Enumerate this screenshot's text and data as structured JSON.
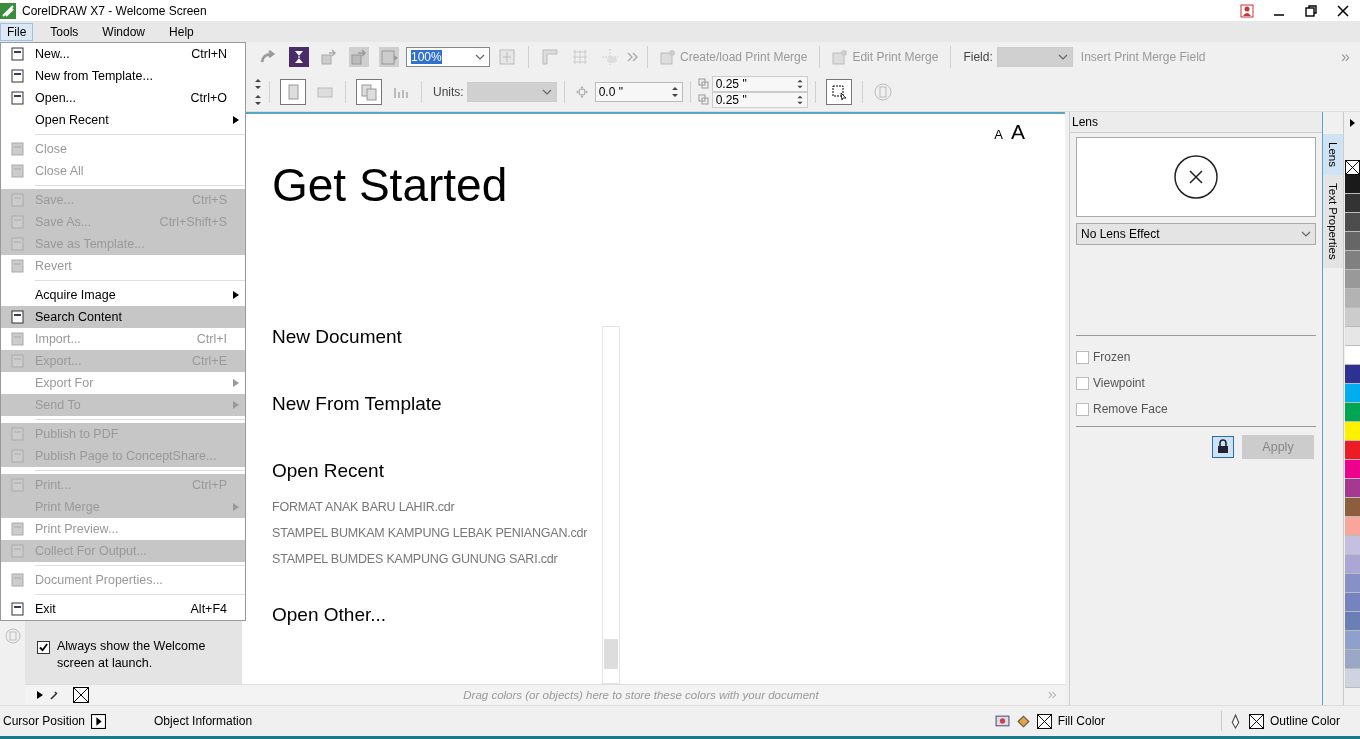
{
  "window": {
    "title": "CorelDRAW X7 - Welcome Screen"
  },
  "menubar": [
    {
      "label": "File",
      "selected": true
    },
    {
      "label": "Tools",
      "selected": false
    },
    {
      "label": "Window",
      "selected": false
    },
    {
      "label": "Help",
      "selected": false
    }
  ],
  "file_menu": [
    {
      "kind": "item",
      "label": "New...",
      "shortcut": "Ctrl+N",
      "disabled": false,
      "highlighted": false,
      "submenu": false,
      "icon": true
    },
    {
      "kind": "item",
      "label": "New from Template...",
      "disabled": false,
      "highlighted": false,
      "submenu": false,
      "icon": true
    },
    {
      "kind": "item",
      "label": "Open...",
      "shortcut": "Ctrl+O",
      "disabled": false,
      "highlighted": false,
      "submenu": false,
      "icon": true
    },
    {
      "kind": "item",
      "label": "Open Recent",
      "disabled": false,
      "highlighted": false,
      "submenu": true,
      "icon": false
    },
    {
      "kind": "separator"
    },
    {
      "kind": "item",
      "label": "Close",
      "disabled": true,
      "highlighted": false,
      "submenu": false,
      "icon": true
    },
    {
      "kind": "item",
      "label": "Close All",
      "disabled": true,
      "highlighted": false,
      "submenu": false,
      "icon": true
    },
    {
      "kind": "separator"
    },
    {
      "kind": "item",
      "label": "Save...",
      "shortcut": "Ctrl+S",
      "disabled": true,
      "highlighted": true,
      "submenu": false,
      "icon": true
    },
    {
      "kind": "item",
      "label": "Save As...",
      "shortcut": "Ctrl+Shift+S",
      "disabled": true,
      "highlighted": true,
      "submenu": false,
      "icon": true
    },
    {
      "kind": "item",
      "label": "Save as Template...",
      "disabled": true,
      "highlighted": true,
      "submenu": false,
      "icon": true
    },
    {
      "kind": "item",
      "label": "Revert",
      "disabled": true,
      "highlighted": false,
      "submenu": false,
      "icon": true
    },
    {
      "kind": "separator"
    },
    {
      "kind": "item",
      "label": "Acquire Image",
      "disabled": false,
      "highlighted": false,
      "submenu": true,
      "icon": false
    },
    {
      "kind": "item",
      "label": "Search Content",
      "disabled": false,
      "highlighted": true,
      "submenu": false,
      "icon": true
    },
    {
      "kind": "item",
      "label": "Import...",
      "shortcut": "Ctrl+I",
      "disabled": true,
      "highlighted": false,
      "submenu": false,
      "icon": true
    },
    {
      "kind": "item",
      "label": "Export...",
      "shortcut": "Ctrl+E",
      "disabled": true,
      "highlighted": true,
      "submenu": false,
      "icon": true
    },
    {
      "kind": "item",
      "label": "Export For",
      "disabled": true,
      "highlighted": false,
      "submenu": true,
      "icon": false
    },
    {
      "kind": "item",
      "label": "Send To",
      "disabled": true,
      "highlighted": true,
      "submenu": true,
      "icon": false
    },
    {
      "kind": "separator"
    },
    {
      "kind": "item",
      "label": "Publish to PDF",
      "disabled": true,
      "highlighted": true,
      "submenu": false,
      "icon": true
    },
    {
      "kind": "item",
      "label": "Publish Page to ConceptShare...",
      "disabled": true,
      "highlighted": true,
      "submenu": false,
      "icon": true
    },
    {
      "kind": "separator"
    },
    {
      "kind": "item",
      "label": "Print...",
      "shortcut": "Ctrl+P",
      "disabled": true,
      "highlighted": true,
      "submenu": false,
      "icon": true
    },
    {
      "kind": "item",
      "label": "Print Merge",
      "disabled": true,
      "highlighted": true,
      "submenu": true,
      "icon": false
    },
    {
      "kind": "item",
      "label": "Print Preview...",
      "disabled": true,
      "highlighted": false,
      "submenu": false,
      "icon": true
    },
    {
      "kind": "item",
      "label": "Collect For Output...",
      "disabled": true,
      "highlighted": true,
      "submenu": false,
      "icon": true
    },
    {
      "kind": "separator"
    },
    {
      "kind": "item",
      "label": "Document Properties...",
      "disabled": true,
      "highlighted": false,
      "submenu": false,
      "icon": true
    },
    {
      "kind": "separator"
    },
    {
      "kind": "item",
      "label": "Exit",
      "shortcut": "Alt+F4",
      "disabled": false,
      "highlighted": false,
      "submenu": false,
      "icon": true
    }
  ],
  "toolbar": {
    "zoom": "100%",
    "create_merge": "Create/load Print Merge",
    "edit_merge": "Edit Print Merge",
    "field_label": "Field:",
    "insert_field": "Insert Print Merge Field",
    "chevron": "»"
  },
  "property_bar": {
    "units_label": "Units:",
    "nudge": "0.0 \"",
    "dup_x": "0.25 \"",
    "dup_y": "0.25 \""
  },
  "welcome": {
    "font_small": "A",
    "font_large": "A",
    "heading": "Get Started",
    "links": [
      {
        "kind": "heading",
        "label": "New Document"
      },
      {
        "kind": "heading",
        "label": "New From Template"
      },
      {
        "kind": "heading",
        "label": "Open Recent"
      },
      {
        "kind": "file",
        "label": "FORMAT ANAK BARU LAHIR.cdr"
      },
      {
        "kind": "file",
        "label": "STAMPEL BUMKAM KAMPUNG LEBAK PENIANGAN.cdr"
      },
      {
        "kind": "file",
        "label": "STAMPEL BUMDES KAMPUNG GUNUNG SARI.cdr"
      },
      {
        "kind": "heading",
        "label": "Open Other..."
      }
    ],
    "always_show": {
      "label": "Always show the Welcome screen at launch.",
      "checked": true
    }
  },
  "lens_docker": {
    "title": "Lens",
    "effect": "No Lens Effect",
    "options": [
      {
        "label": "Frozen",
        "checked": false
      },
      {
        "label": "Viewpoint",
        "checked": false
      },
      {
        "label": "Remove Face",
        "checked": false
      }
    ],
    "apply": "Apply"
  },
  "docker_tabs": [
    {
      "label": "Lens",
      "selected": true
    },
    {
      "label": "Text Properties",
      "selected": false
    }
  ],
  "palette": [
    {
      "color": "#1a1a1a"
    },
    {
      "color": "#333333"
    },
    {
      "color": "#4d4d4d"
    },
    {
      "color": "#666666"
    },
    {
      "color": "#808080"
    },
    {
      "color": "#999999"
    },
    {
      "color": "#b3b3b3"
    },
    {
      "color": "#cccccc"
    },
    {
      "color": "#e6e6e6"
    },
    {
      "color": "#ffffff"
    },
    {
      "color": "#2e3192"
    },
    {
      "color": "#00aeef"
    },
    {
      "color": "#00a651"
    },
    {
      "color": "#fff200"
    },
    {
      "color": "#ed1c24"
    },
    {
      "color": "#ec008c"
    },
    {
      "color": "#a4398f"
    },
    {
      "color": "#8b5e3c"
    },
    {
      "color": "#f9a59a"
    },
    {
      "color": "#c6c0e0"
    },
    {
      "color": "#aba7d4"
    },
    {
      "color": "#8891c7"
    },
    {
      "color": "#7583c0"
    },
    {
      "color": "#6a7fb5"
    },
    {
      "color": "#8fa0cc"
    },
    {
      "color": "#9aa7c5"
    },
    {
      "color": "#cfd3e0"
    }
  ],
  "color_strip": {
    "hint": "Drag colors (or objects) here to store these colors with your document"
  },
  "status_bar": {
    "cursor_position": "Cursor Position",
    "object_info": "Object Information",
    "fill": "Fill Color",
    "outline": "Outline Color"
  }
}
